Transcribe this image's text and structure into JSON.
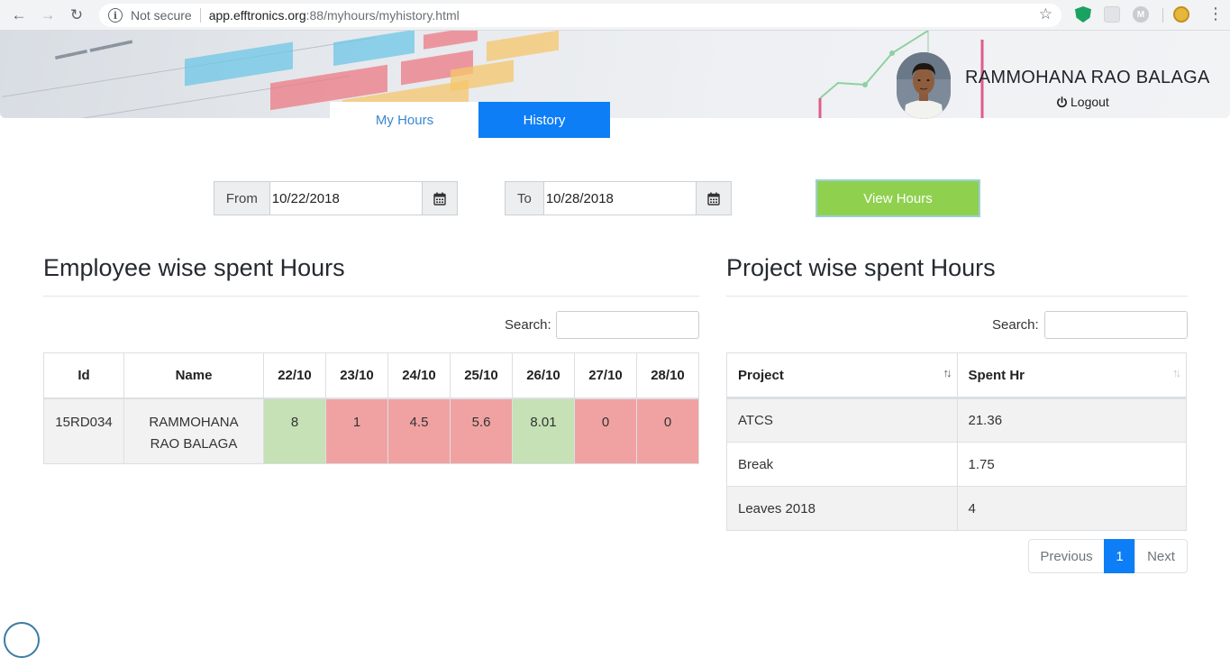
{
  "browser": {
    "security_label": "Not secure",
    "url_host": "app.efftronics.org",
    "url_path": ":88/myhours/myhistory.html",
    "ext_m_label": "M"
  },
  "header": {
    "user_name": "RAMMOHANA RAO BALAGA",
    "logout_label": "Logout"
  },
  "tabs": [
    {
      "label": "My Hours",
      "active": false
    },
    {
      "label": "History",
      "active": true
    }
  ],
  "filters": {
    "from_label": "From",
    "from_value": "10/22/2018",
    "to_label": "To",
    "to_value": "10/28/2018",
    "view_button": "View Hours"
  },
  "employee_section": {
    "title": "Employee wise spent Hours",
    "search_label": "Search:",
    "columns": [
      "Id",
      "Name",
      "22/10",
      "23/10",
      "24/10",
      "25/10",
      "26/10",
      "27/10",
      "28/10"
    ],
    "row": {
      "id": "15RD034",
      "name_line1": "RAMMOHANA",
      "name_line2": "RAO BALAGA",
      "values": [
        "8",
        "1",
        "4.5",
        "5.6",
        "8.01",
        "0",
        "0"
      ],
      "status": [
        "ok",
        "low",
        "low",
        "low",
        "ok",
        "low",
        "low"
      ]
    },
    "colors": {
      "ok": "#c5e1b5",
      "low": "#f0a2a2"
    }
  },
  "project_section": {
    "title": "Project wise spent Hours",
    "search_label": "Search:",
    "columns": [
      "Project",
      "Spent Hr"
    ],
    "rows": [
      {
        "project": "ATCS",
        "hours": "21.36"
      },
      {
        "project": "Break",
        "hours": "1.75"
      },
      {
        "project": "Leaves 2018",
        "hours": "4"
      }
    ],
    "pagination": {
      "previous": "Previous",
      "current": "1",
      "next": "Next"
    }
  }
}
